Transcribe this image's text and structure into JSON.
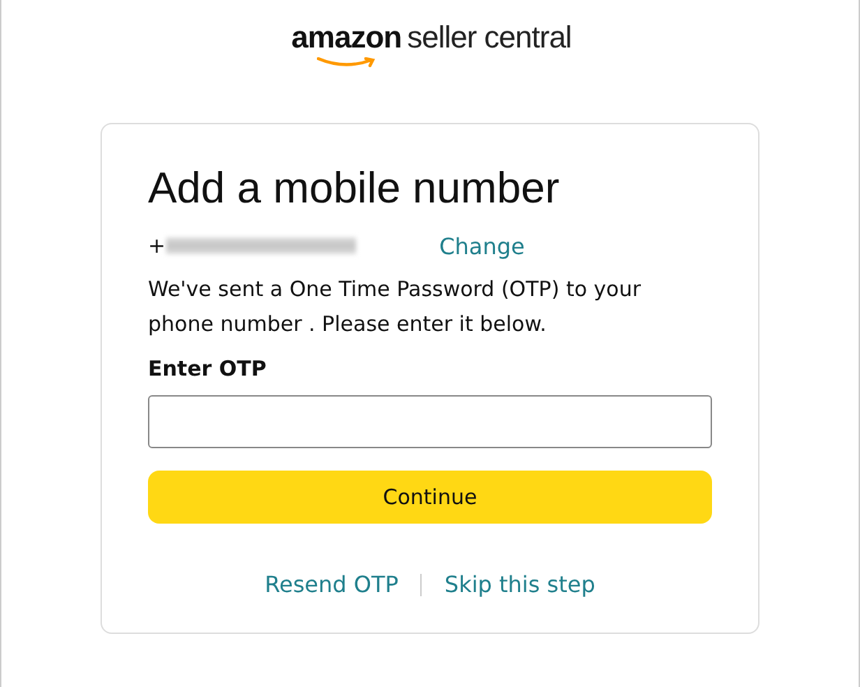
{
  "logo": {
    "brand": "amazon",
    "product": "seller central"
  },
  "card": {
    "title": "Add a mobile number",
    "phone": {
      "prefix": "+",
      "redacted": true,
      "change_link": "Change"
    },
    "message": "We've sent a One Time Password (OTP) to your phone number . Please enter it below.",
    "otp_field": {
      "label": "Enter OTP"
    },
    "continue_button": "Continue",
    "links": [
      "Resend OTP",
      "Skip this step"
    ]
  }
}
